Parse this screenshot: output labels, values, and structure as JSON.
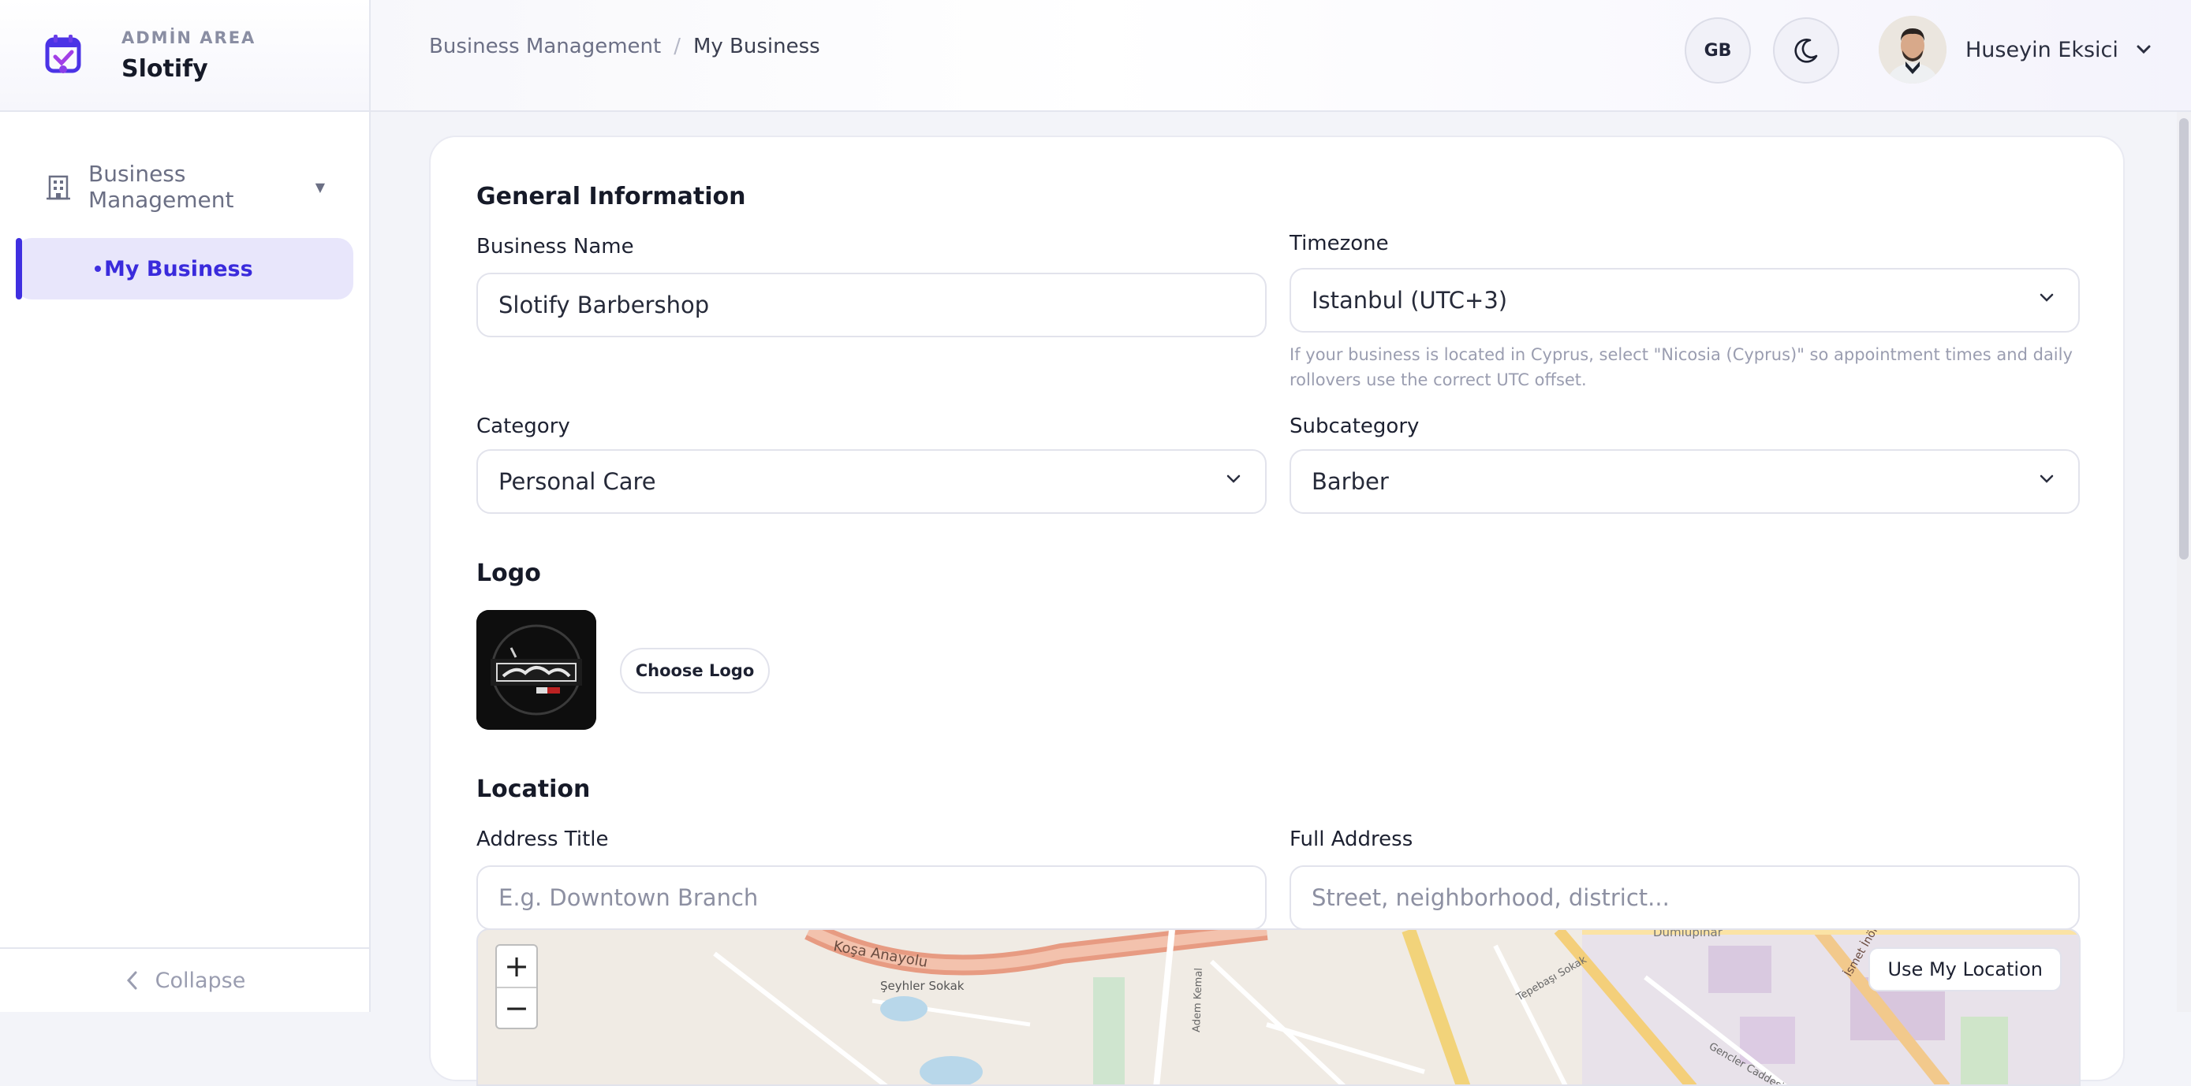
{
  "brand": {
    "area": "ADMİN AREA",
    "name": "Slotify"
  },
  "sidebar": {
    "group_label": "Business Management",
    "items": [
      {
        "label": "My Business",
        "active": true
      }
    ],
    "collapse_label": "Collapse"
  },
  "topbar": {
    "breadcrumb": {
      "parent": "Business Management",
      "separator": "/",
      "current": "My Business"
    },
    "language": "GB",
    "user_name": "Huseyin Eksici"
  },
  "general": {
    "title": "General Information",
    "business_name_label": "Business Name",
    "business_name_value": "Slotify Barbershop",
    "timezone_label": "Timezone",
    "timezone_value": "Istanbul (UTC+3)",
    "timezone_hint": "If your business is located in Cyprus, select \"Nicosia (Cyprus)\" so appointment times and daily rollovers use the correct UTC offset.",
    "category_label": "Category",
    "category_value": "Personal Care",
    "subcategory_label": "Subcategory",
    "subcategory_value": "Barber"
  },
  "logo": {
    "title": "Logo",
    "choose_label": "Choose Logo"
  },
  "location": {
    "title": "Location",
    "address_title_label": "Address Title",
    "address_title_placeholder": "E.g. Downtown Branch",
    "full_address_label": "Full Address",
    "full_address_placeholder": "Street, neighborhood, district...",
    "map": {
      "zoom_in": "+",
      "zoom_out": "−",
      "use_location_label": "Use My Location",
      "street_labels": [
        "Koşa Anayolu",
        "Şeyhler Sokak",
        "Adem Kemal",
        "Tepebaşı Sokak",
        "Gencler Caddesi",
        "İsmet İnönü B",
        "Dumlupınar"
      ]
    }
  },
  "colors": {
    "accent": "#3f2fe0",
    "active_bg": "#e8e6fb",
    "page_bg": "#f3f4f9"
  }
}
